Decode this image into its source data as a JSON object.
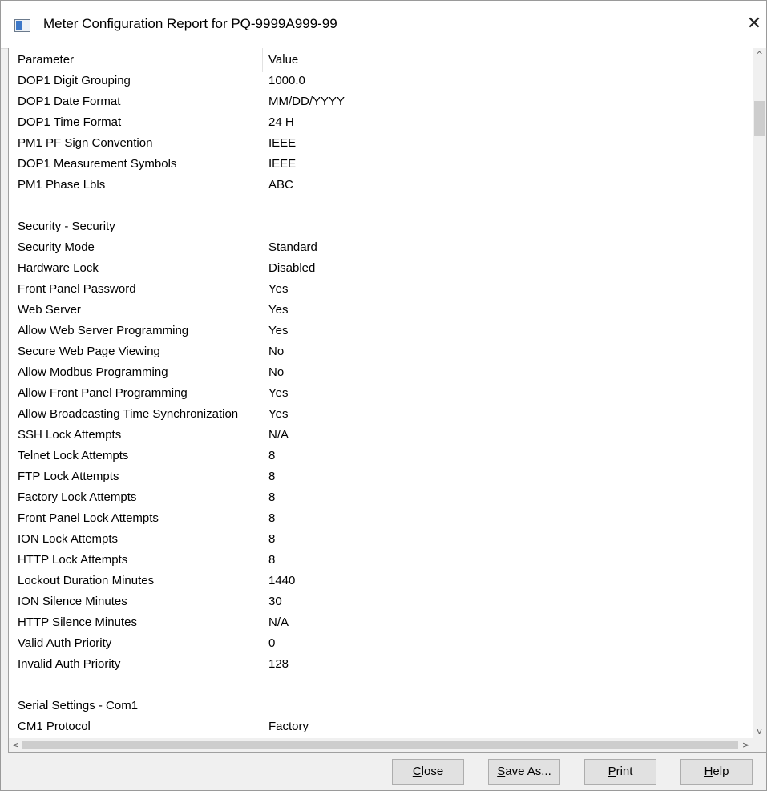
{
  "window": {
    "title": "Meter Configuration Report for PQ-9999A999-99",
    "close_glyph": "✕"
  },
  "table": {
    "headers": {
      "parameter": "Parameter",
      "value": "Value"
    },
    "rows": [
      {
        "p": "DOP1 Digit Grouping",
        "v": "1000.0"
      },
      {
        "p": "DOP1 Date Format",
        "v": "MM/DD/YYYY"
      },
      {
        "p": "DOP1 Time Format",
        "v": "24 H"
      },
      {
        "p": "PM1 PF Sign Convention",
        "v": "IEEE"
      },
      {
        "p": "DOP1 Measurement Symbols",
        "v": "IEEE"
      },
      {
        "p": "PM1 Phase Lbls",
        "v": "ABC"
      },
      {
        "p": "",
        "v": ""
      },
      {
        "p": "Security - Security",
        "v": ""
      },
      {
        "p": "Security Mode",
        "v": "Standard"
      },
      {
        "p": "Hardware Lock",
        "v": "Disabled"
      },
      {
        "p": "Front Panel Password",
        "v": "Yes"
      },
      {
        "p": "Web Server",
        "v": "Yes"
      },
      {
        "p": "Allow Web Server Programming",
        "v": "Yes"
      },
      {
        "p": "Secure Web Page Viewing",
        "v": "No"
      },
      {
        "p": "Allow Modbus Programming",
        "v": "No"
      },
      {
        "p": "Allow Front Panel Programming",
        "v": "Yes"
      },
      {
        "p": "Allow Broadcasting Time Synchronization",
        "v": "Yes"
      },
      {
        "p": "SSH Lock Attempts",
        "v": "N/A"
      },
      {
        "p": "Telnet Lock Attempts",
        "v": "8"
      },
      {
        "p": "FTP Lock Attempts",
        "v": "8"
      },
      {
        "p": "Factory Lock Attempts",
        "v": "8"
      },
      {
        "p": "Front Panel Lock Attempts",
        "v": "8"
      },
      {
        "p": "ION Lock Attempts",
        "v": "8"
      },
      {
        "p": "HTTP Lock Attempts",
        "v": "8"
      },
      {
        "p": "Lockout Duration Minutes",
        "v": "1440"
      },
      {
        "p": "ION Silence Minutes",
        "v": "30"
      },
      {
        "p": "HTTP Silence Minutes",
        "v": "N/A"
      },
      {
        "p": "Valid Auth Priority",
        "v": "0"
      },
      {
        "p": "Invalid Auth Priority",
        "v": "128"
      },
      {
        "p": "",
        "v": ""
      },
      {
        "p": "Serial Settings - Com1",
        "v": ""
      },
      {
        "p": "CM1 Protocol",
        "v": "Factory"
      }
    ]
  },
  "scrollbars": {
    "up_glyph": "^",
    "down_glyph": "v",
    "left_glyph": "<",
    "right_glyph": ">"
  },
  "buttons": {
    "close": {
      "mnemonic": "C",
      "rest": "lose"
    },
    "save_as": {
      "mnemonic": "S",
      "rest": "ave As..."
    },
    "print": {
      "mnemonic": "P",
      "rest": "rint"
    },
    "help": {
      "mnemonic": "H",
      "rest": "elp"
    }
  }
}
